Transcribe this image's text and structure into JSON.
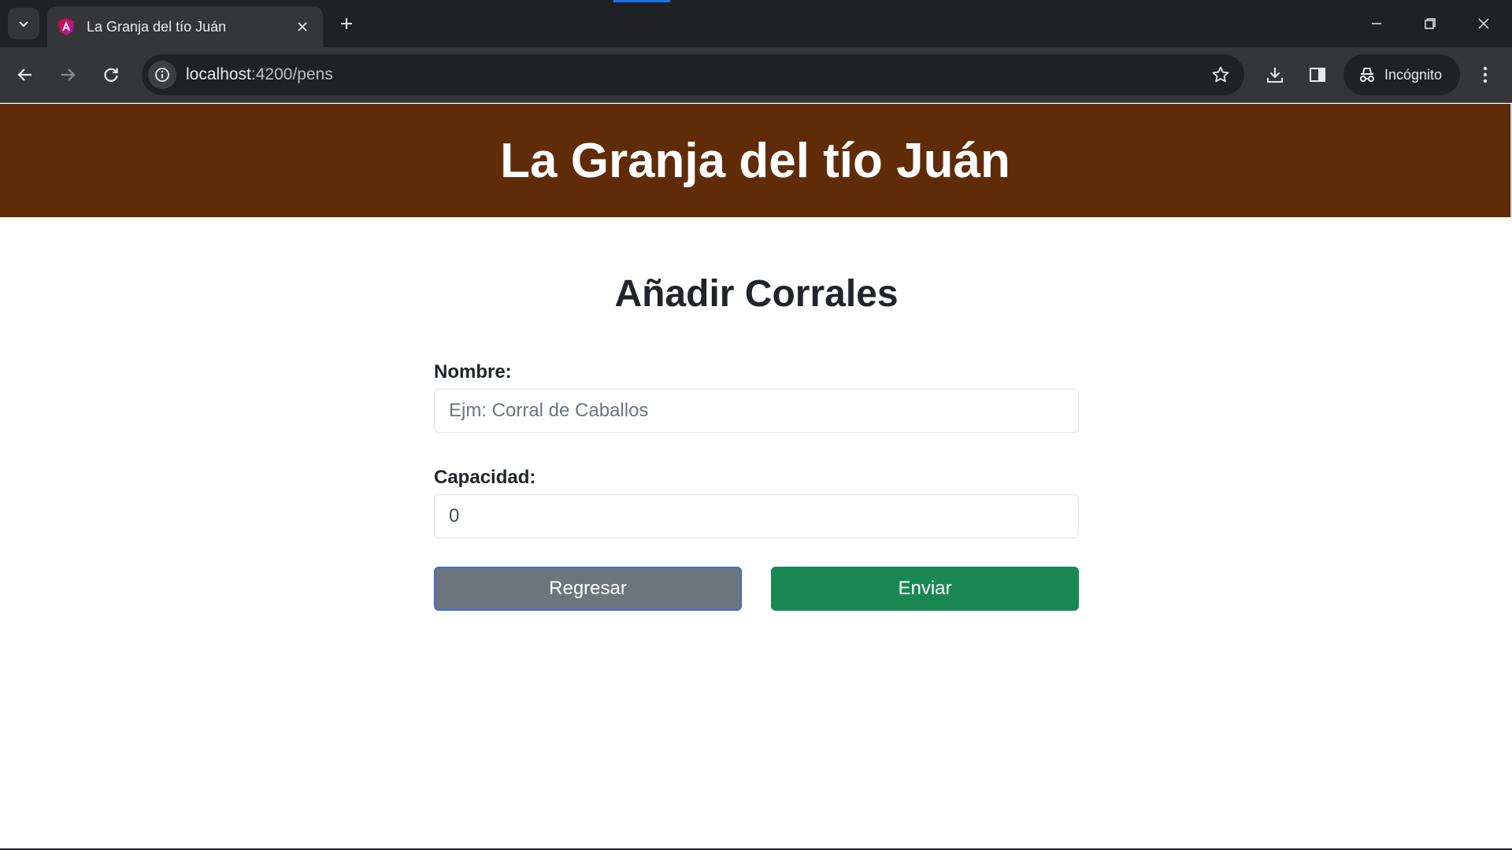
{
  "browser": {
    "tab_title": "La Granja del tío Juán",
    "url_host": "localhost",
    "url_path": ":4200/pens",
    "profile_label": "Incógnito"
  },
  "page": {
    "header_title": "La Granja del tío Juán",
    "form_title": "Añadir Corrales",
    "fields": {
      "name_label": "Nombre:",
      "name_placeholder": "Ejm: Corral de Caballos",
      "name_value": "",
      "capacity_label": "Capacidad:",
      "capacity_value": "0"
    },
    "buttons": {
      "back_label": "Regresar",
      "submit_label": "Enviar"
    }
  },
  "colors": {
    "header_bg": "#602c08",
    "back_button": "#6c757d",
    "submit_button": "#198754",
    "browser_chrome": "#35363a"
  },
  "icons": {
    "tab_search": "chevron-down-icon",
    "favicon": "angular-icon",
    "tab_close": "close-icon",
    "new_tab": "plus-icon",
    "back": "arrow-left-icon",
    "forward": "arrow-right-icon",
    "reload": "reload-icon",
    "site_info": "info-icon",
    "bookmark": "star-icon",
    "download": "download-icon",
    "side_panel": "side-panel-icon",
    "incognito": "incognito-icon",
    "menu": "kebab-menu-icon"
  }
}
